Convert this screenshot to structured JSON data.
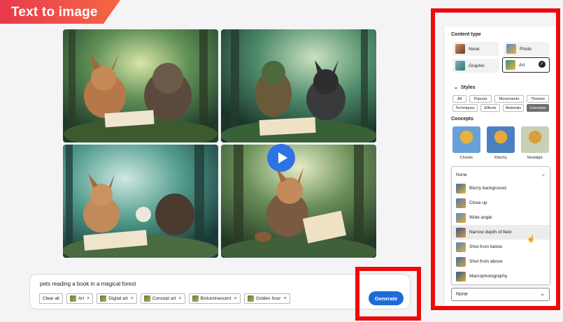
{
  "header": {
    "title": "Text to image"
  },
  "prompt": {
    "text": "pets reading a book in a magical forest",
    "clear_all": "Clear all",
    "chips": [
      {
        "label": "Art",
        "remove": "×"
      },
      {
        "label": "Digital art",
        "remove": "×"
      },
      {
        "label": "Concept art",
        "remove": "×"
      },
      {
        "label": "Bioluminescent",
        "remove": "×"
      },
      {
        "label": "Golden hour",
        "remove": "×"
      }
    ],
    "generate_label": "Generate"
  },
  "panel": {
    "content_type_label": "Content type",
    "content_types": [
      {
        "label": "None",
        "selected": false
      },
      {
        "label": "Photo",
        "selected": false
      },
      {
        "label": "Graphic",
        "selected": false
      },
      {
        "label": "Art",
        "selected": true
      }
    ],
    "styles_label": "Styles",
    "style_tabs_row1": [
      "All",
      "Popular",
      "Movements",
      "Themes"
    ],
    "style_tabs_row2": [
      "Techniques",
      "Effects",
      "Materials",
      "Concepts"
    ],
    "active_tab": "Concepts",
    "concepts_label": "Concepts",
    "concepts": [
      "Chaotic",
      "Kitschy",
      "Nostalgic"
    ],
    "dropdown_items": [
      {
        "label": "None",
        "checked": true
      },
      {
        "label": "Blurry background"
      },
      {
        "label": "Close up"
      },
      {
        "label": "Wide angle"
      },
      {
        "label": "Narrow depth of field",
        "hover": true
      },
      {
        "label": "Shot from below"
      },
      {
        "label": "Shot from above"
      },
      {
        "label": "Macrophotography"
      }
    ],
    "select_value": "None"
  },
  "icons": {
    "checkmark": "✓",
    "chevron": "⌄",
    "play": "play-icon"
  },
  "colors": {
    "accent_blue": "#1f6ad8",
    "highlight_red": "#ee0a0a",
    "banner_start": "#e8394a",
    "banner_end": "#f4663f"
  }
}
